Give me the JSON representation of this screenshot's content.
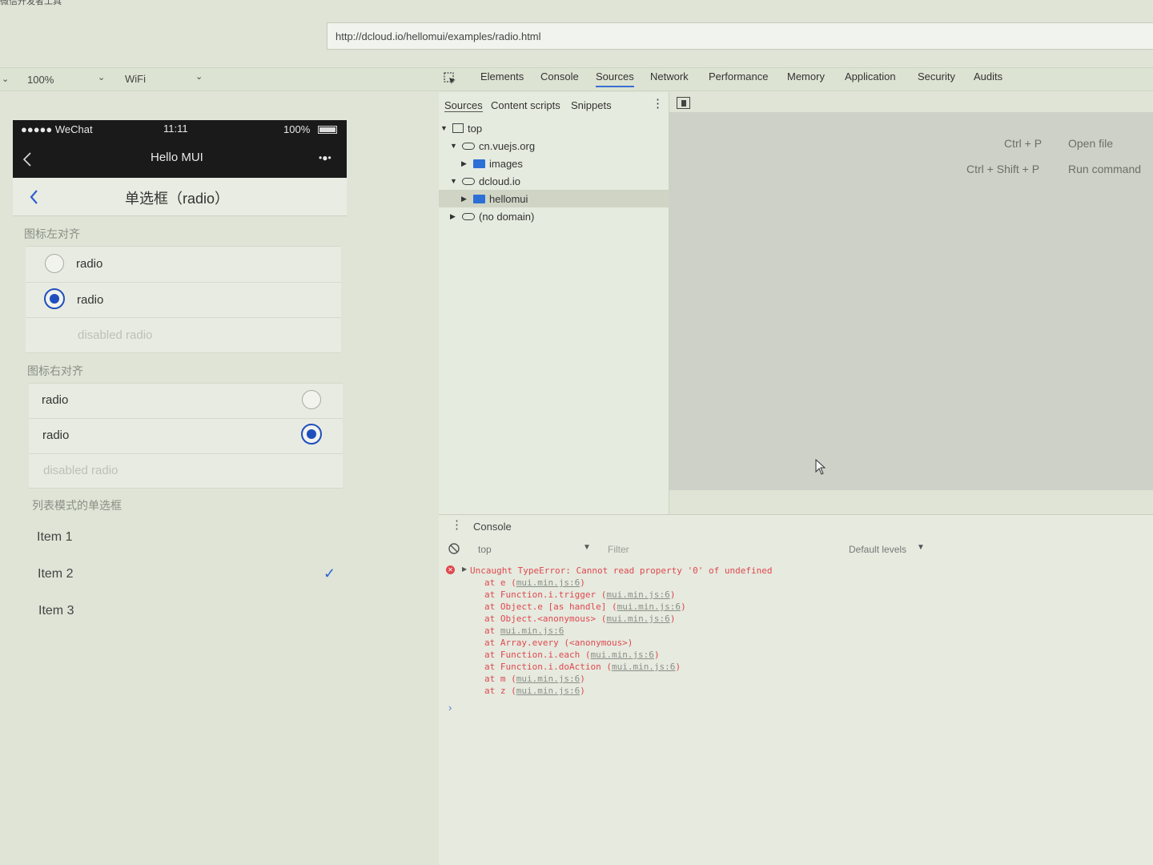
{
  "window": {
    "title": "微信开发者工具",
    "url": "http://dcloud.io/hellomui/examples/radio.html"
  },
  "device_toolbar": {
    "zoom": "100%",
    "network": "WiFi"
  },
  "devtools": {
    "tabs": [
      "Elements",
      "Console",
      "Sources",
      "Network",
      "Performance",
      "Memory",
      "Application",
      "Security",
      "Audits"
    ],
    "active_tab": "Sources",
    "sources_subtabs": [
      "Sources",
      "Content scripts",
      "Snippets"
    ],
    "tree": [
      {
        "label": "top",
        "type": "frame",
        "expanded": true
      },
      {
        "label": "cn.vuejs.org",
        "type": "domain",
        "expanded": true
      },
      {
        "label": "images",
        "type": "folder",
        "expanded": false
      },
      {
        "label": "dcloud.io",
        "type": "domain",
        "expanded": true
      },
      {
        "label": "hellomui",
        "type": "folder",
        "expanded": false,
        "selected": true
      },
      {
        "label": "(no domain)",
        "type": "domain",
        "expanded": false
      }
    ],
    "shortcuts": [
      {
        "keys": "Ctrl + P",
        "action": "Open file"
      },
      {
        "keys": "Ctrl + Shift + P",
        "action": "Run command"
      }
    ]
  },
  "console": {
    "title": "Console",
    "context": "top",
    "filter_placeholder": "Filter",
    "levels": "Default levels",
    "error": "Uncaught TypeError: Cannot read property '0' of undefined",
    "stack": [
      {
        "prefix": "at e (",
        "link": "mui.min.js:6",
        "suffix": ")"
      },
      {
        "prefix": "at Function.i.trigger (",
        "link": "mui.min.js:6",
        "suffix": ")"
      },
      {
        "prefix": "at Object.e [as handle] (",
        "link": "mui.min.js:6",
        "suffix": ")"
      },
      {
        "prefix": "at Object.<anonymous> (",
        "link": "mui.min.js:6",
        "suffix": ")"
      },
      {
        "prefix": "at ",
        "link": "mui.min.js:6",
        "suffix": ""
      },
      {
        "prefix": "at Array.every (<anonymous>)",
        "link": "",
        "suffix": ""
      },
      {
        "prefix": "at Function.i.each (",
        "link": "mui.min.js:6",
        "suffix": ")"
      },
      {
        "prefix": "at Function.i.doAction (",
        "link": "mui.min.js:6",
        "suffix": ")"
      },
      {
        "prefix": "at m (",
        "link": "mui.min.js:6",
        "suffix": ")"
      },
      {
        "prefix": "at z (",
        "link": "mui.min.js:6",
        "suffix": ")"
      }
    ],
    "prompt": "›"
  },
  "phone": {
    "carrier": "●●●●● WeChat",
    "time": "11:11",
    "battery": "100%",
    "title": "Hello MUI",
    "menu": "•●•",
    "page_title": "单选框（radio）",
    "section_left": "图标左对齐",
    "section_right": "图标右对齐",
    "section_list": "列表模式的单选框",
    "left_items": [
      {
        "label": "radio",
        "checked": false,
        "disabled": false
      },
      {
        "label": "radio",
        "checked": true,
        "disabled": false
      },
      {
        "label": "disabled radio",
        "checked": false,
        "disabled": true
      }
    ],
    "right_items": [
      {
        "label": "radio",
        "checked": false,
        "disabled": false
      },
      {
        "label": "radio",
        "checked": true,
        "disabled": false
      },
      {
        "label": "disabled radio",
        "checked": false,
        "disabled": true
      }
    ],
    "list_items": [
      {
        "label": "Item 1",
        "checked": false
      },
      {
        "label": "Item 2",
        "checked": true
      },
      {
        "label": "Item 3",
        "checked": false
      }
    ]
  },
  "colors": {
    "accent": "#1f4fbf",
    "error": "#e0484f",
    "active_tab": "#3b6fd4"
  }
}
